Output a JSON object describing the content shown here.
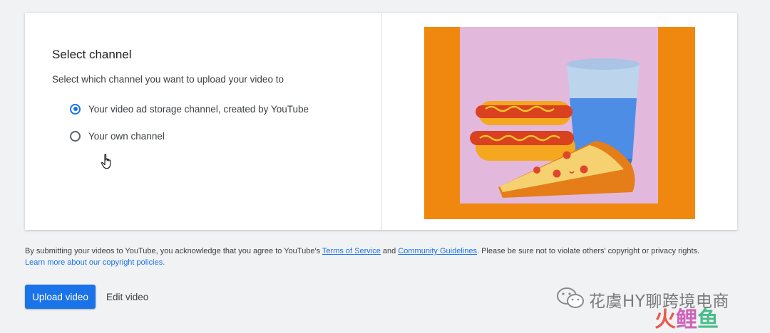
{
  "dialog": {
    "title": "Select channel",
    "subtitle": "Select which channel you want to upload your video to",
    "options": [
      {
        "label": "Your video ad storage channel, created by YouTube",
        "selected": true
      },
      {
        "label": "Your own channel",
        "selected": false
      }
    ]
  },
  "terms": {
    "prefix": "By submitting your videos to YouTube, you acknowledge that you agree to YouTube's ",
    "tos_link": "Terms of Service",
    "and": " and ",
    "guidelines_link": "Community Guidelines",
    "suffix": ". Please be sure not to violate others' copyright or privacy rights. ",
    "copyright_link": "Learn more about our copyright policies."
  },
  "actions": {
    "upload_label": "Upload video",
    "edit_label": "Edit video"
  },
  "watermark": {
    "line1": "花虞HY聊跨境电商",
    "logo_part1": "火",
    "logo_part2": "鲤",
    "logo_part3": "鱼"
  },
  "colors": {
    "accent": "#1a73e8",
    "illustration_frame": "#f0880f",
    "illustration_bg": "#e3b8dd"
  },
  "icons": {
    "radio_selected": "radio-checked-icon",
    "radio_unselected": "radio-unchecked-icon",
    "cursor": "hand-pointer-cursor-icon",
    "watermark": "wechat-icon"
  }
}
